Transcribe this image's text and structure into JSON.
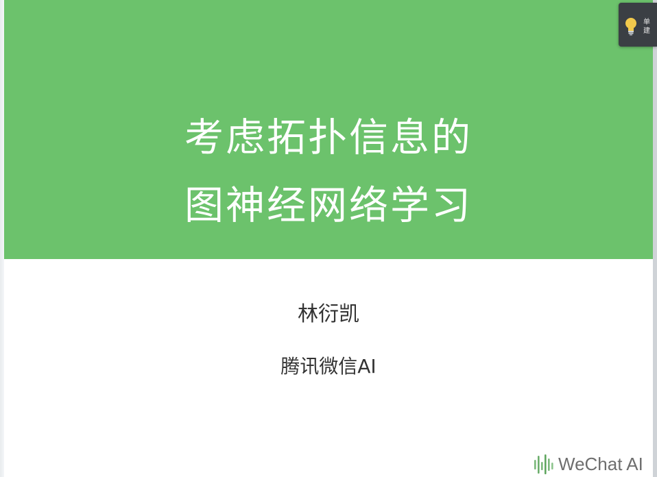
{
  "slide": {
    "title_line_1": "考虑拓扑信息的",
    "title_line_2": "图神经网络学习",
    "author": "林衍凯",
    "affiliation": "腾讯微信AI",
    "logo_text": "WeChat AI",
    "banner_color": "#6cc26c"
  },
  "hint_popup": {
    "icon": "lightbulb-icon",
    "line_1": "单",
    "line_2": "建"
  }
}
